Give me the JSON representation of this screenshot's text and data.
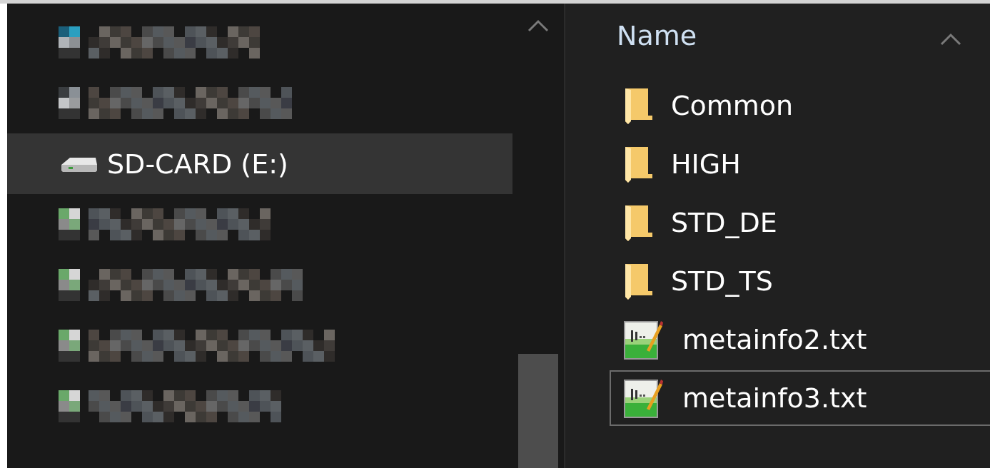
{
  "navigation_pane": {
    "items": [
      {
        "kind": "redacted",
        "selected": false
      },
      {
        "kind": "redacted",
        "selected": false
      },
      {
        "kind": "drive",
        "label": "SD-CARD (E:)",
        "selected": true
      },
      {
        "kind": "redacted",
        "selected": false
      },
      {
        "kind": "redacted",
        "selected": false
      },
      {
        "kind": "redacted",
        "selected": false
      },
      {
        "kind": "redacted",
        "selected": false
      }
    ]
  },
  "file_list": {
    "column_header": "Name",
    "items": [
      {
        "kind": "folder",
        "name": "Common",
        "selected": false
      },
      {
        "kind": "folder",
        "name": "HIGH",
        "selected": false
      },
      {
        "kind": "folder",
        "name": "STD_DE",
        "selected": false
      },
      {
        "kind": "folder",
        "name": "STD_TS",
        "selected": false
      },
      {
        "kind": "text",
        "name": "metainfo2.txt",
        "selected": false
      },
      {
        "kind": "text",
        "name": "metainfo3.txt",
        "selected": true
      }
    ]
  }
}
